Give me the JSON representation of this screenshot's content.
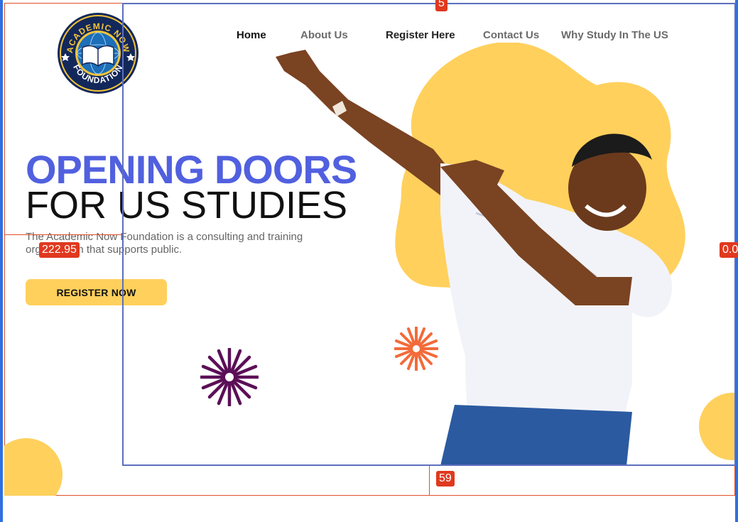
{
  "brand": {
    "logo_text_top": "ACADEMIC NOW",
    "logo_text_bottom": "FOUNDATION",
    "colors": {
      "navy": "#13285a",
      "gold": "#f3c43a",
      "accent_blue": "#5160df",
      "yellow": "#ffd05c",
      "purple": "#5b0f57",
      "orange": "#f36b3a"
    }
  },
  "nav": {
    "items": [
      {
        "label": "Home"
      },
      {
        "label": "About Us"
      },
      {
        "label": "Register Here"
      },
      {
        "label": "Contact Us"
      },
      {
        "label": "Why Study In The US"
      }
    ]
  },
  "hero": {
    "headline_line1": "OPENING DOORS",
    "headline_line2": "FOR US STUDIES",
    "description": "The Academic Now Foundation is a consulting and training organization that supports public.",
    "cta_label": "REGISTER NOW"
  },
  "overlay_badges": {
    "top": "5",
    "left": "222.95",
    "right": "0.0",
    "bottom": "59"
  },
  "icons": [
    "starburst-icon",
    "open-book-icon",
    "star-icon"
  ]
}
